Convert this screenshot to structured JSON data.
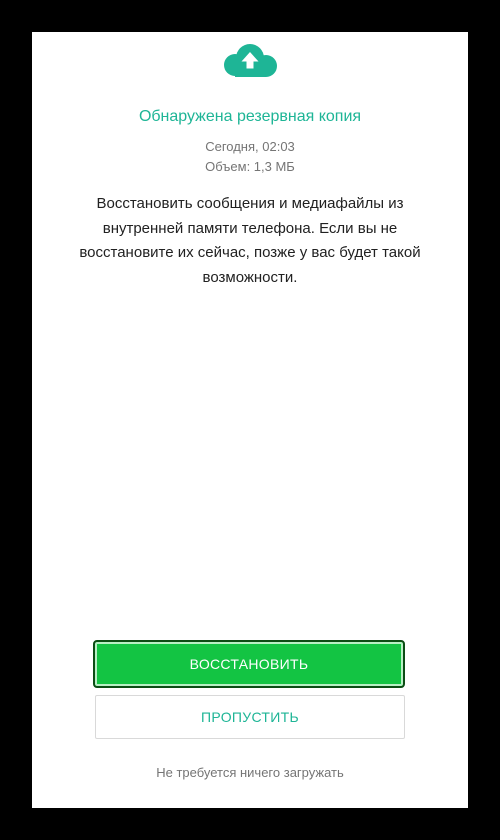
{
  "colors": {
    "accent": "#1eb596",
    "restore_button": "#13c443",
    "secondary_text": "#757575",
    "body_text": "#212121"
  },
  "header": {
    "icon": "cloud-upload-icon",
    "title": "Обнаружена резервная копия",
    "date": "Сегодня, 02:03",
    "size": "Объем: 1,3 МБ"
  },
  "description": "Восстановить сообщения и медиафайлы из внутренней памяти телефона. Если вы не восстановите их сейчас, позже у вас будет такой возможности.",
  "actions": {
    "restore_label": "ВОССТАНОВИТЬ",
    "skip_label": "ПРОПУСТИТЬ"
  },
  "footer": {
    "note": "Не требуется ничего загружать"
  }
}
